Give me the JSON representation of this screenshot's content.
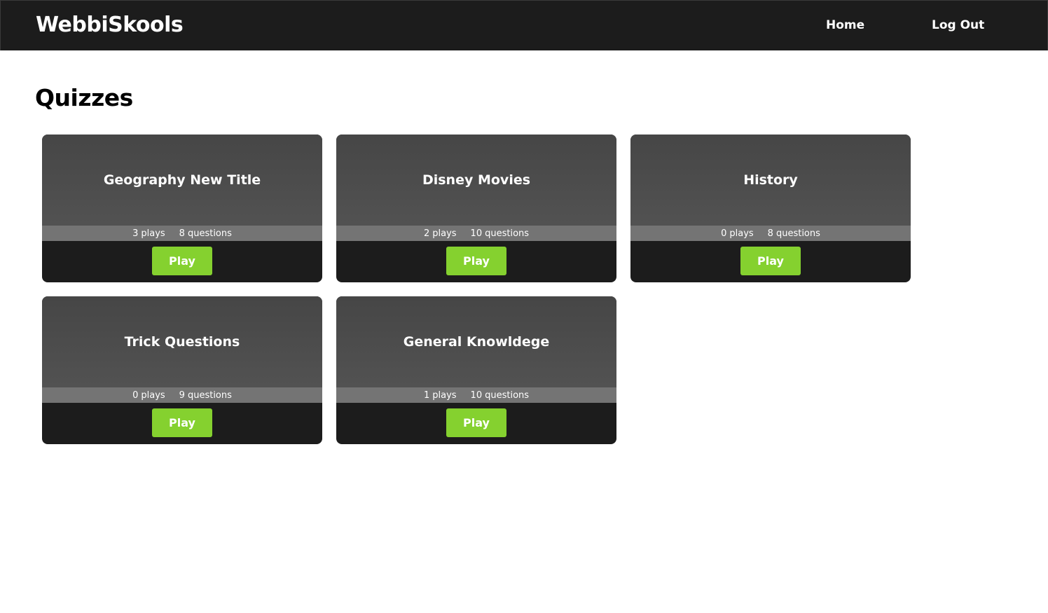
{
  "navbar": {
    "brand": "WebbiSkools",
    "links": [
      {
        "label": "Home"
      },
      {
        "label": "Log Out"
      }
    ]
  },
  "page": {
    "title": "Quizzes"
  },
  "quizzes": [
    {
      "title": "Geography New Title",
      "plays": "3",
      "plays_label": "plays",
      "questions": "8",
      "questions_label": "questions",
      "button": "Play"
    },
    {
      "title": "Disney Movies",
      "plays": "2",
      "plays_label": "plays",
      "questions": "10",
      "questions_label": "questions",
      "button": "Play"
    },
    {
      "title": "History",
      "plays": "0",
      "plays_label": "plays",
      "questions": "8",
      "questions_label": "questions",
      "button": "Play"
    },
    {
      "title": "Trick Questions",
      "plays": "0",
      "plays_label": "plays",
      "questions": "9",
      "questions_label": "questions",
      "button": "Play"
    },
    {
      "title": "General Knowldege",
      "plays": "1",
      "plays_label": "plays",
      "questions": "10",
      "questions_label": "questions",
      "button": "Play"
    }
  ],
  "colors": {
    "navbar_bg": "#1c1c1c",
    "card_head_bg": "#4a4a4a",
    "card_meta_bg": "#747474",
    "card_foot_bg": "#1c1c1c",
    "play_button": "#85d12f"
  }
}
